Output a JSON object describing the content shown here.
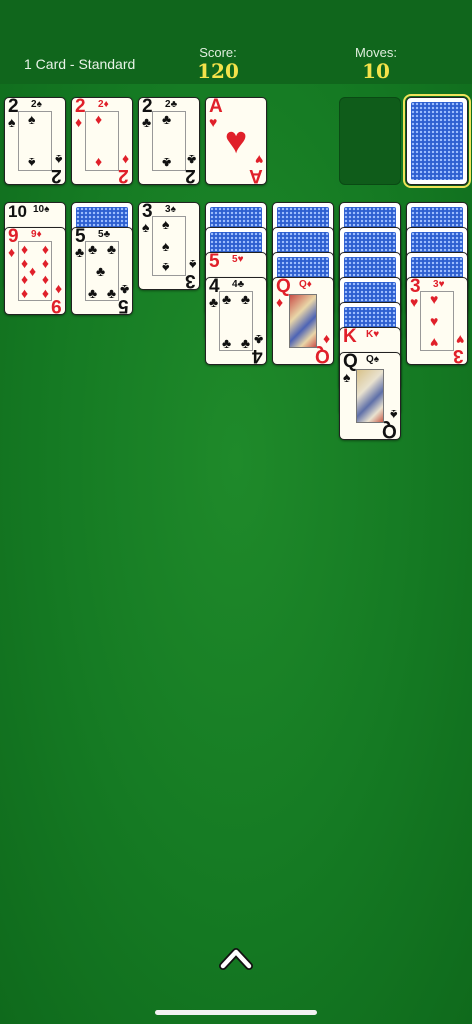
{
  "header": {
    "mode": "1 Card - Standard",
    "score_label": "Score:",
    "score_value": "120",
    "moves_label": "Moves:",
    "moves_value": "10"
  },
  "foundations": [
    {
      "rank": "2",
      "suit": "♠",
      "color": "black"
    },
    {
      "rank": "2",
      "suit": "♦",
      "color": "red"
    },
    {
      "rank": "2",
      "suit": "♣",
      "color": "black"
    },
    {
      "rank": "A",
      "suit": "♥",
      "color": "red"
    }
  ],
  "tableau": {
    "col1": [
      {
        "rank": "10",
        "suit": "♠"
      },
      {
        "rank": "9",
        "suit": "♦"
      }
    ],
    "col2": [
      {
        "rank": "5",
        "suit": "♣"
      }
    ],
    "col3": [
      {
        "rank": "3",
        "suit": "♠"
      }
    ],
    "col4": [
      {
        "rank": "5",
        "suit": "♥"
      },
      {
        "rank": "4",
        "suit": "♣"
      }
    ],
    "col5": [
      {
        "rank": "Q",
        "suit": "♦"
      }
    ],
    "col6": [
      {
        "rank": "K",
        "suit": "♥"
      },
      {
        "rank": "Q",
        "suit": "♠"
      }
    ],
    "col7": [
      {
        "rank": "3",
        "suit": "♥"
      }
    ]
  },
  "colors": {
    "table_green": "#157a23",
    "hud_green": "#10661c",
    "score_yellow": "#f4e24a",
    "card_back_blue": "#2d5fd0"
  },
  "icons": {
    "menu_toggle": "chevron-up-icon"
  }
}
